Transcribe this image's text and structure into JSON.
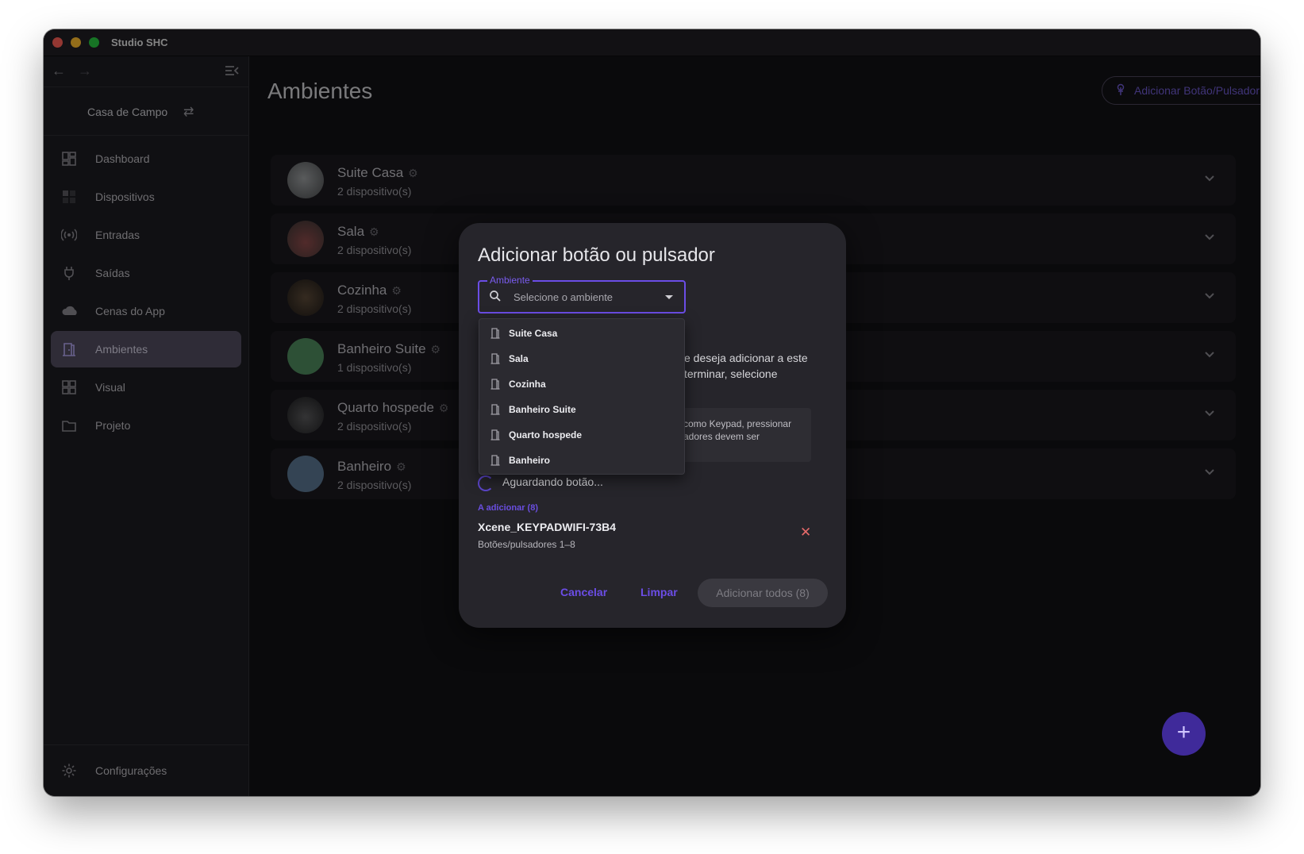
{
  "window": {
    "title": "Studio SHC"
  },
  "sidebar": {
    "home": "Casa de Campo",
    "items": [
      {
        "label": "Dashboard",
        "icon": "dashboard-icon"
      },
      {
        "label": "Dispositivos",
        "icon": "devices-icon"
      },
      {
        "label": "Entradas",
        "icon": "radio-signal-icon"
      },
      {
        "label": "Saídas",
        "icon": "plug-icon"
      },
      {
        "label": "Cenas do App",
        "icon": "cloud-icon"
      },
      {
        "label": "Ambientes",
        "icon": "door-icon",
        "active": true
      },
      {
        "label": "Visual",
        "icon": "grid-icon"
      },
      {
        "label": "Projeto",
        "icon": "folder-icon"
      }
    ],
    "settings": "Configurações"
  },
  "main": {
    "title": "Ambientes",
    "add_button": "Adicionar Botão/Pulsador",
    "rooms": [
      {
        "name": "Suite Casa",
        "count": "2 dispositivo(s)",
        "avatar_color": "#6b6e70"
      },
      {
        "name": "Sala",
        "count": "2 dispositivo(s)",
        "avatar_color": "#6a5a55"
      },
      {
        "name": "Cozinha",
        "count": "2 dispositivo(s)",
        "avatar_color": "#4b4036"
      },
      {
        "name": "Banheiro Suite",
        "count": "1 dispositivo(s)",
        "avatar_color": "#4f8a5e"
      },
      {
        "name": "Quarto hospede",
        "count": "2 dispositivo(s)",
        "avatar_color": "#3b3b3d"
      },
      {
        "name": "Banheiro",
        "count": "2 dispositivo(s)",
        "avatar_color": "#5b7691"
      }
    ]
  },
  "dialog": {
    "title": "Adicionar botão ou pulsador",
    "select_label": "Ambiente",
    "select_placeholder": "Selecione o ambiente",
    "visible_text_line1": "e deseja adicionar a este",
    "visible_text_line2": "terminar, selecione",
    "info_line1": "como Keypad, pressionar",
    "info_line2": "adores devem ser",
    "waiting": "Aguardando botão...",
    "to_add_header": "A adicionar (8)",
    "device": {
      "name": "Xcene_KEYPADWIFI-73B4",
      "sub": "Botões/pulsadores 1–8"
    },
    "cancel": "Cancelar",
    "clear": "Limpar",
    "add_all": "Adicionar todos (8)"
  },
  "dropdown": {
    "options": [
      "Suite Casa",
      "Sala",
      "Cozinha",
      "Banheiro Suite",
      "Quarto hospede",
      "Banheiro"
    ]
  },
  "colors": {
    "accent": "#6b4de6",
    "fab": "#3f2a9a"
  }
}
